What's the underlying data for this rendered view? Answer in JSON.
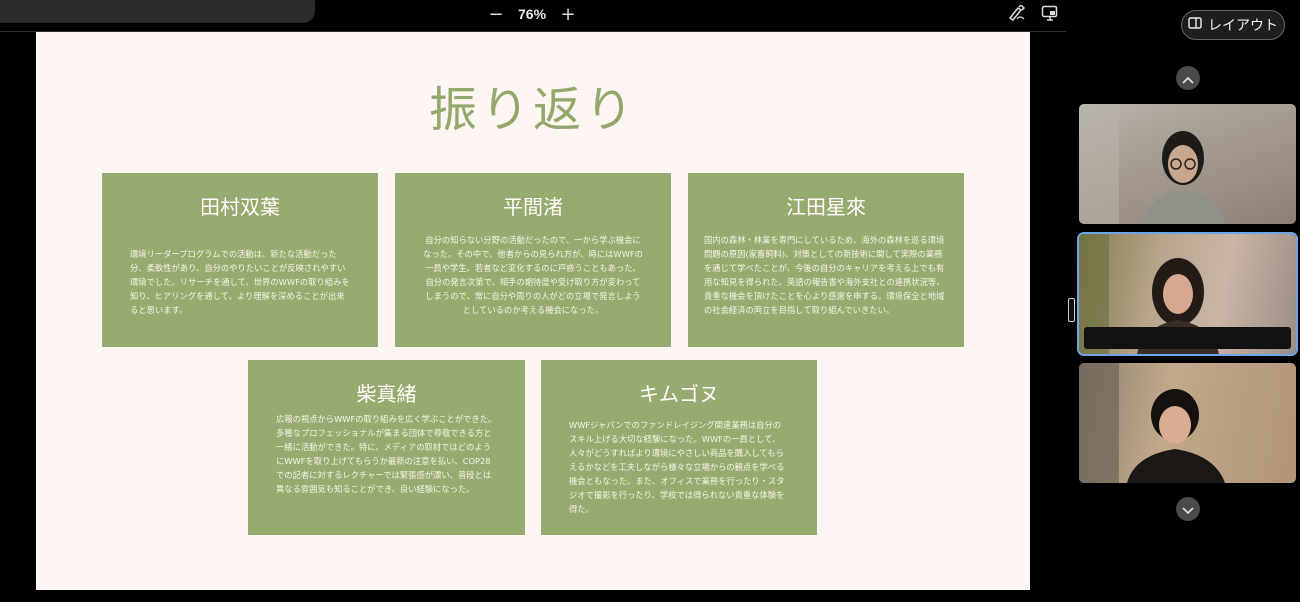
{
  "toolbar": {
    "zoom_out_label": "−",
    "zoom_level": "76%",
    "zoom_in_label": "+",
    "layout_label": "レイアウト",
    "icons": [
      "pen-icon",
      "screen-share-icon",
      "layout-icon"
    ]
  },
  "slide": {
    "title": "振り返り",
    "colors": {
      "background": "#fdf6f3",
      "accent": "#93a86a",
      "card": "#97aa6f"
    },
    "cards": [
      {
        "name": "田村双葉",
        "text": "環境リーダープログラムでの活動は、新たな活動だった分、柔軟性があり、自分のやりたいことが反映されやすい環境でした。リサーチを通して、世界のWWFの取り組みを知り、ヒアリングを通して、より理解を深めることが出来ると思います。"
      },
      {
        "name": "平間渚",
        "text": "自分の知らない分野の活動だったので、一から学ぶ機会になった。その中で、他者からの見られ方が、時にはWWFの一員や学生、若者など変化するのに戸惑うこともあった。自分の発言次第で、相手の期待度や受け取り方が変わってしまうので、常に自分や周りの人がどの立場で発言しようとしているのか考える機会になった。"
      },
      {
        "name": "江田星來",
        "text": "国内の森林・林業を専門にしているため、海外の森林を巡る環境問題の原因(家畜飼料)、対策としての新技術に関して実際の業務を通じて学べたことが、今後の自分のキャリアを考える上でも有用な知見を得られた。英語の報告書や海外支社との連携状況等、貴重な機会を頂けたことを心より感謝を申する。環境保全と地域の社会経済の両立を目指して取り組んでいきたい。"
      },
      {
        "name": "柴真緒",
        "text": "広報の視点からWWFの取り組みを広く学ぶことができた。多種なプロフェッショナルが集まる団体で尊敬できる方と一緒に活動ができた。特に、メディアの取材ではどのようにWWFを取り上げてもらうか最新の注意を払い、COP28での記者に対するレクチャーでは緊張感が漂い、普段とは異なる雰囲気も知ることができ、良い経験になった。"
      },
      {
        "name": "キムゴヌ",
        "text": "WWFジャパンでのファンドレイジング関連業務は自分のスキル上げる大切な経験になった。WWFの一員として、人々がどうすればより環境にやさしい商品を購入してもらえるかなどを工夫しながら様々な立場からの観点を学べる機会ともなった。また、オフィスで業務を行ったり・スタジオで撮影を行ったり、学校では得られない貴重な体験を得た。"
      }
    ]
  },
  "participants": [
    {
      "tile": "participant-1",
      "active": false
    },
    {
      "tile": "participant-2",
      "active": true
    },
    {
      "tile": "participant-3",
      "active": false
    }
  ]
}
